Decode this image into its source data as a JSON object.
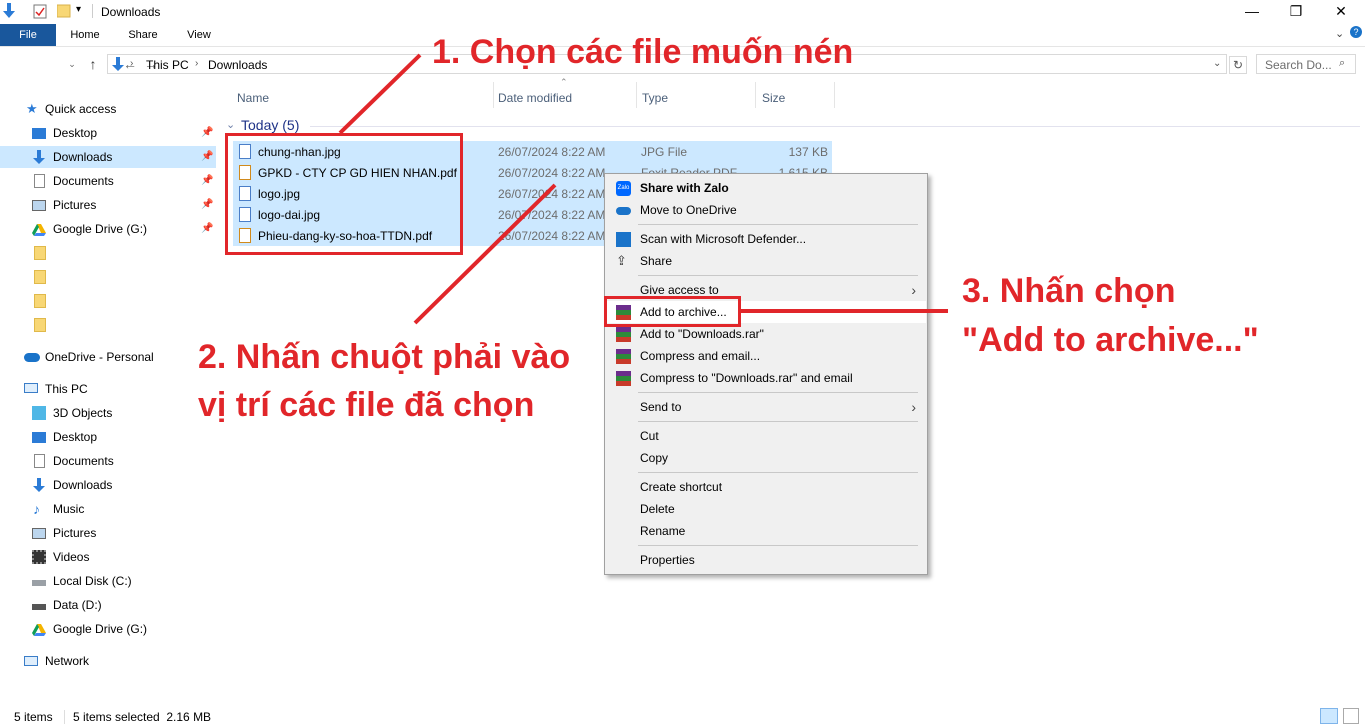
{
  "window": {
    "title": "Downloads"
  },
  "ribbon": {
    "tabs": [
      "File",
      "Home",
      "Share",
      "View"
    ]
  },
  "address": {
    "crumbs": [
      "This PC",
      "Downloads"
    ],
    "search_placeholder": "Search Do..."
  },
  "columns": [
    "Name",
    "Date modified",
    "Type",
    "Size"
  ],
  "group": "Today (5)",
  "files": [
    {
      "name": "chung-nhan.jpg",
      "date": "26/07/2024 8:22 AM",
      "type": "JPG File",
      "size": "137 KB"
    },
    {
      "name": "GPKD - CTY CP GD HIEN NHAN.pdf",
      "date": "26/07/2024 8:22 AM",
      "type": "Foxit Reader PDF ...",
      "size": "1,615 KB"
    },
    {
      "name": "logo.jpg",
      "date": "26/07/2024 8:22 AM",
      "type": "",
      "size": ""
    },
    {
      "name": "logo-dai.jpg",
      "date": "26/07/2024 8:22 AM",
      "type": "",
      "size": ""
    },
    {
      "name": "Phieu-dang-ky-so-hoa-TTDN.pdf",
      "date": "26/07/2024 8:22 AM",
      "type": "",
      "size": ""
    }
  ],
  "nav": {
    "quick_access": "Quick access",
    "quick_items": [
      "Desktop",
      "Downloads",
      "Documents",
      "Pictures",
      "Google Drive (G:)"
    ],
    "onedrive": "OneDrive - Personal",
    "this_pc": "This PC",
    "pc_items": [
      "3D Objects",
      "Desktop",
      "Documents",
      "Downloads",
      "Music",
      "Pictures",
      "Videos",
      "Local Disk (C:)",
      "Data (D:)",
      "Google Drive (G:)"
    ],
    "network": "Network"
  },
  "context_menu": {
    "items": [
      "Share with Zalo",
      "Move to OneDrive",
      "Scan with Microsoft Defender...",
      "Share",
      "Give access to",
      "Add to archive...",
      "Add to \"Downloads.rar\"",
      "Compress and email...",
      "Compress to \"Downloads.rar\" and email",
      "Send to",
      "Cut",
      "Copy",
      "Create shortcut",
      "Delete",
      "Rename",
      "Properties"
    ]
  },
  "annotations": {
    "step1": "1. Chọn các file muốn nén",
    "step2_line1": "2. Nhấn chuột phải vào",
    "step2_line2": "vị trí các file đã chọn",
    "step3_line1": "3. Nhấn chọn",
    "step3_line2": "\"Add to archive...\""
  },
  "status": {
    "items": "5 items",
    "selected": "5 items selected  2.16 MB"
  },
  "colors": {
    "accent": "#e1262a",
    "selection": "#cce8ff",
    "file_tab": "#19579c"
  }
}
